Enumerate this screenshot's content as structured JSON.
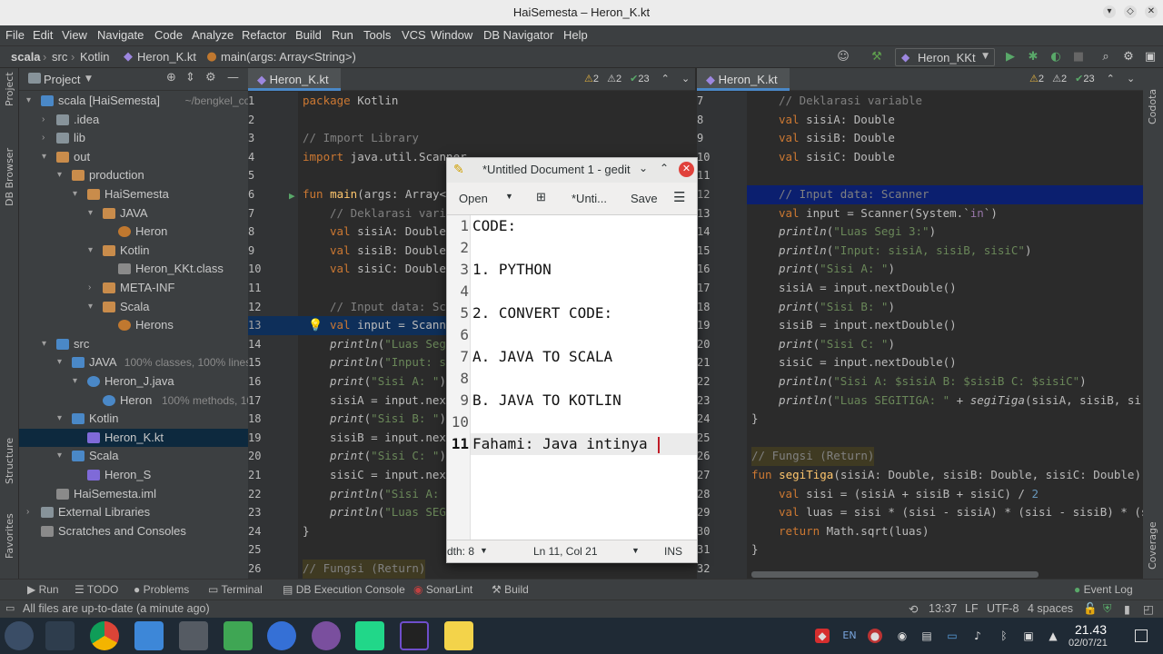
{
  "window": {
    "title": "HaiSemesta – Heron_K.kt"
  },
  "menu": [
    "File",
    "Edit",
    "View",
    "Navigate",
    "Code",
    "Analyze",
    "Refactor",
    "Build",
    "Run",
    "Tools",
    "VCS",
    "Window",
    "DB Navigator",
    "Help"
  ],
  "breadcrumb": [
    "scala",
    "src",
    "Kotlin",
    "Heron_K.kt",
    "main(args: Array<String>)"
  ],
  "run_config": "Heron_KKt",
  "project_panel": {
    "title": "Project"
  },
  "left_strip": [
    "Project",
    "DB Browser",
    "Structure",
    "Favorites"
  ],
  "right_strip": [
    "Codota",
    "Coverage"
  ],
  "tree": [
    {
      "label": "scala [HaiSemesta]",
      "hint": "~/bengkel_code/"
    },
    {
      "label": ".idea"
    },
    {
      "label": "lib"
    },
    {
      "label": "out"
    },
    {
      "label": "production"
    },
    {
      "label": "HaiSemesta"
    },
    {
      "label": "JAVA"
    },
    {
      "label": "Heron"
    },
    {
      "label": "Kotlin"
    },
    {
      "label": "Heron_KKt.class"
    },
    {
      "label": "META-INF"
    },
    {
      "label": "Scala"
    },
    {
      "label": "Herons"
    },
    {
      "label": "src"
    },
    {
      "label": "JAVA",
      "hint": "100% classes, 100% lines c"
    },
    {
      "label": "Heron_J.java"
    },
    {
      "label": "Heron",
      "hint": "100% methods, 10"
    },
    {
      "label": "Kotlin"
    },
    {
      "label": "Heron_K.kt"
    },
    {
      "label": "Scala"
    },
    {
      "label": "Heron_S"
    },
    {
      "label": "HaiSemesta.iml"
    },
    {
      "label": "External Libraries"
    },
    {
      "label": "Scratches and Consoles"
    }
  ],
  "left_editor": {
    "tab": "Heron_K.kt",
    "warnings": {
      "a": "2",
      "b": "2",
      "c": "23"
    },
    "line_numbers": [
      "1",
      "2",
      "3",
      "4",
      "5",
      "6",
      "7",
      "8",
      "9",
      "10",
      "11",
      "12",
      "13",
      "14",
      "15",
      "16",
      "17",
      "18",
      "19",
      "20",
      "21",
      "22",
      "23",
      "24",
      "25",
      "26"
    ]
  },
  "right_editor": {
    "tab": "Heron_K.kt",
    "warnings": {
      "a": "2",
      "b": "2",
      "c": "23"
    },
    "line_numbers": [
      "7",
      "8",
      "9",
      "10",
      "11",
      "12",
      "13",
      "14",
      "15",
      "16",
      "17",
      "18",
      "19",
      "20",
      "21",
      "22",
      "23",
      "24",
      "25",
      "26",
      "27",
      "28",
      "29",
      "30",
      "31",
      "32"
    ]
  },
  "gedit": {
    "title": "*Untitled Document 1 - gedit",
    "open_label": "Open",
    "tab_label": "*Unti...",
    "save_label": "Save",
    "lines": [
      "CODE:",
      "",
      "1. PYTHON",
      "",
      "2. CONVERT CODE:",
      "",
      "A. JAVA TO SCALA",
      "",
      "B. JAVA TO KOTLIN",
      "",
      "Fahami: Java intinya"
    ],
    "status": {
      "width": "dth: 8",
      "position": "Ln 11, Col 21",
      "mode": "INS"
    }
  },
  "tool_windows": [
    "Run",
    "TODO",
    "Problems",
    "Terminal",
    "DB Execution Console",
    "SonarLint",
    "Build",
    "Event Log"
  ],
  "status_bar": {
    "message": "All files are up-to-date (a minute ago)",
    "position": "13:37",
    "line_sep": "LF",
    "encoding": "UTF-8",
    "indent": "4 spaces"
  },
  "taskbar": {
    "time": "21.43",
    "date": "02/07/21",
    "lang": "EN"
  },
  "colors": {
    "accent": "#4a88c7",
    "keyword": "#cc7832",
    "string": "#6a8759",
    "comment": "#808080"
  }
}
